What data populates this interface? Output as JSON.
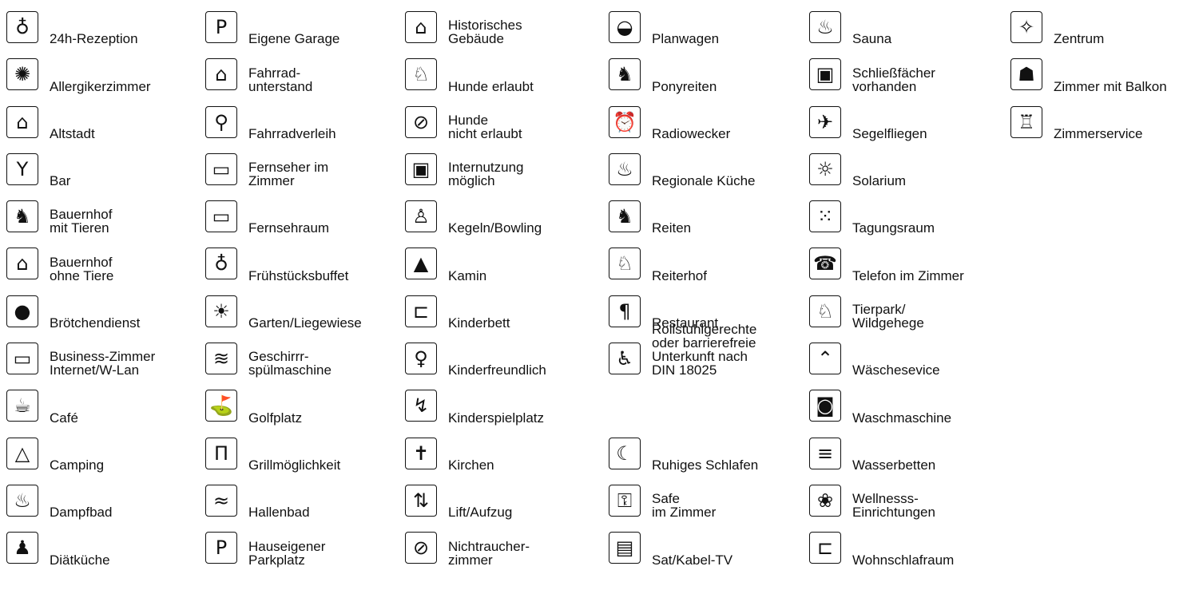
{
  "columns": [
    {
      "items": [
        {
          "icon": "reception-bell-icon",
          "glyph": "♁",
          "label": "24h-Rezeption"
        },
        {
          "icon": "allergy-sun-icon",
          "glyph": "✺",
          "label": "Allergikerzimmer"
        },
        {
          "icon": "old-town-icon",
          "glyph": "⌂",
          "label": "Altstadt"
        },
        {
          "icon": "cocktail-glass-icon",
          "glyph": "Y",
          "label": "Bar"
        },
        {
          "icon": "farm-animals-icon",
          "glyph": "♞",
          "label": "Bauernhof\nmit Tieren"
        },
        {
          "icon": "farm-house-icon",
          "glyph": "⌂",
          "label": "Bauernhof\nohne Tiere"
        },
        {
          "icon": "bread-roll-icon",
          "glyph": "●",
          "label": "Brötchendienst"
        },
        {
          "icon": "laptop-wifi-icon",
          "glyph": "▭",
          "label": "Business-Zimmer\nInternet/W-Lan"
        },
        {
          "icon": "coffee-cup-icon",
          "glyph": "☕",
          "label": "Café"
        },
        {
          "icon": "tent-icon",
          "glyph": "△",
          "label": "Camping"
        },
        {
          "icon": "steam-bath-icon",
          "glyph": "♨",
          "label": "Dampfbad"
        },
        {
          "icon": "diet-kitchen-icon",
          "glyph": "♟",
          "label": "Diätküche"
        }
      ]
    },
    {
      "items": [
        {
          "icon": "parking-garage-icon",
          "glyph": "P",
          "label": "Eigene  Garage"
        },
        {
          "icon": "bike-shelter-icon",
          "glyph": "⌂",
          "label": "Fahrrad-\nunterstand"
        },
        {
          "icon": "bicycle-icon",
          "glyph": "⚲",
          "label": "Fahrradverleih"
        },
        {
          "icon": "tv-icon",
          "glyph": "▭",
          "label": "Fernseher im\nZimmer"
        },
        {
          "icon": "tv-room-icon",
          "glyph": "▭",
          "label": "Fernsehraum"
        },
        {
          "icon": "egg-cup-icon",
          "glyph": "♁",
          "label": "Frühstücksbuffet"
        },
        {
          "icon": "garden-lounger-icon",
          "glyph": "☀",
          "label": "Garten/Liegewiese"
        },
        {
          "icon": "dishwasher-icon",
          "glyph": "≋",
          "label": "Geschirrr-\nspülmaschine"
        },
        {
          "icon": "golfer-icon",
          "glyph": "⛳",
          "label": "Golfplatz"
        },
        {
          "icon": "grill-icon",
          "glyph": "Π",
          "label": "Grillmöglichkeit"
        },
        {
          "icon": "swimmer-icon",
          "glyph": "≈",
          "label": "Hallenbad"
        },
        {
          "icon": "parking-icon",
          "glyph": "P",
          "label": "Hauseigener\nParkplatz"
        }
      ]
    },
    {
      "items": [
        {
          "icon": "historic-building-icon",
          "glyph": "⌂",
          "label": "Historisches\nGebäude"
        },
        {
          "icon": "dog-icon",
          "glyph": "♘",
          "label": "Hunde erlaubt"
        },
        {
          "icon": "no-dog-icon",
          "glyph": "⊘",
          "label": "Hunde\nnicht erlaubt"
        },
        {
          "icon": "computer-icon",
          "glyph": "▣",
          "label": "Internutzung\nmöglich"
        },
        {
          "icon": "bowling-icon",
          "glyph": "♙",
          "label": "Kegeln/Bowling"
        },
        {
          "icon": "fireplace-icon",
          "glyph": "▲",
          "label": "Kamin"
        },
        {
          "icon": "child-bed-icon",
          "glyph": "⊏",
          "label": "Kinderbett"
        },
        {
          "icon": "child-icon",
          "glyph": "♀",
          "label": "Kinderfreundlich"
        },
        {
          "icon": "playground-swing-icon",
          "glyph": "↯",
          "label": "Kinderspielplatz"
        },
        {
          "icon": "church-icon",
          "glyph": "✝",
          "label": "Kirchen"
        },
        {
          "icon": "elevator-icon",
          "glyph": "⇅",
          "label": "Lift/Aufzug"
        },
        {
          "icon": "no-smoking-icon",
          "glyph": "⊘",
          "label": "Nichtraucher-\nzimmer"
        }
      ]
    },
    {
      "items": [
        {
          "icon": "covered-wagon-icon",
          "glyph": "◒",
          "label": "Planwagen"
        },
        {
          "icon": "pony-rider-icon",
          "glyph": "♞",
          "label": "Ponyreiten"
        },
        {
          "icon": "radio-alarm-icon",
          "glyph": "⏰",
          "label": "Radiowecker"
        },
        {
          "icon": "cooking-pot-icon",
          "glyph": "♨",
          "label": "Regionale Küche"
        },
        {
          "icon": "horse-rider-icon",
          "glyph": "♞",
          "label": "Reiten"
        },
        {
          "icon": "riding-stable-icon",
          "glyph": "♘",
          "label": "Reiterhof"
        },
        {
          "icon": "fork-knife-icon",
          "glyph": "¶",
          "label": "Restaurant"
        },
        {
          "icon": "wheelchair-icon",
          "glyph": "♿",
          "label": "Rollstuhlgerechte\noder barrierefreie\nUnterkunft nach\nDIN 18025"
        },
        {
          "icon": "",
          "glyph": "",
          "label": ""
        },
        {
          "icon": "quiet-sleep-icon",
          "glyph": "☾",
          "label": "Ruhiges Schlafen"
        },
        {
          "icon": "safe-key-icon",
          "glyph": "⚿",
          "label": "Safe\nim Zimmer"
        },
        {
          "icon": "sat-tv-icon",
          "glyph": "▤",
          "label": "Sat/Kabel-TV"
        }
      ]
    },
    {
      "items": [
        {
          "icon": "sauna-icon",
          "glyph": "♨",
          "label": "Sauna"
        },
        {
          "icon": "lockers-icon",
          "glyph": "▣",
          "label": "Schließfächer\nvorhanden"
        },
        {
          "icon": "glider-icon",
          "glyph": "✈",
          "label": "Segelfliegen"
        },
        {
          "icon": "solarium-icon",
          "glyph": "☼",
          "label": "Solarium"
        },
        {
          "icon": "meeting-room-icon",
          "glyph": "⁙",
          "label": "Tagungsraum"
        },
        {
          "icon": "telephone-icon",
          "glyph": "☎",
          "label": "Telefon im Zimmer"
        },
        {
          "icon": "deer-icon",
          "glyph": "♘",
          "label": "Tierpark/\nWildgehege"
        },
        {
          "icon": "hanger-shirt-icon",
          "glyph": "⌃",
          "label": "Wäschesevice"
        },
        {
          "icon": "washing-machine-icon",
          "glyph": "◙",
          "label": "Waschmaschine"
        },
        {
          "icon": "waterbed-icon",
          "glyph": "≡",
          "label": "Wasserbetten"
        },
        {
          "icon": "wellness-lotus-icon",
          "glyph": "❀",
          "label": "Wellnesss-\nEinrichtungen"
        },
        {
          "icon": "sofa-bed-icon",
          "glyph": "⊏",
          "label": "Wohnschlafraum"
        }
      ]
    },
    {
      "items": [
        {
          "icon": "center-target-icon",
          "glyph": "✧",
          "label": "Zentrum"
        },
        {
          "icon": "balcony-icon",
          "glyph": "☗",
          "label": "Zimmer mit Balkon"
        },
        {
          "icon": "room-service-icon",
          "glyph": "♖",
          "label": "Zimmerservice"
        }
      ]
    }
  ]
}
